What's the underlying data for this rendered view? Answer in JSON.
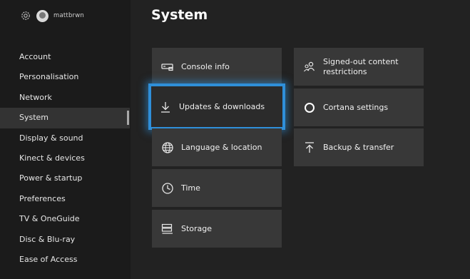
{
  "header": {
    "username": "mattbrwn",
    "page_title": "System"
  },
  "sidebar": {
    "items": [
      {
        "label": "Account",
        "active": false
      },
      {
        "label": "Personalisation",
        "active": false
      },
      {
        "label": "Network",
        "active": false
      },
      {
        "label": "System",
        "active": true
      },
      {
        "label": "Display & sound",
        "active": false
      },
      {
        "label": "Kinect & devices",
        "active": false
      },
      {
        "label": "Power & startup",
        "active": false
      },
      {
        "label": "Preferences",
        "active": false
      },
      {
        "label": "TV & OneGuide",
        "active": false
      },
      {
        "label": "Disc & Blu-ray",
        "active": false
      },
      {
        "label": "Ease of Access",
        "active": false
      }
    ]
  },
  "tiles": {
    "console_info": {
      "label": "Console info",
      "icon": "console-icon"
    },
    "updates": {
      "label": "Updates & downloads",
      "icon": "download-icon",
      "focused": true
    },
    "language": {
      "label": "Language & location",
      "icon": "globe-icon"
    },
    "time": {
      "label": "Time",
      "icon": "clock-icon"
    },
    "storage": {
      "label": "Storage",
      "icon": "storage-icon"
    },
    "signed_out": {
      "label": "Signed-out content restrictions",
      "icon": "users-lock-icon"
    },
    "cortana": {
      "label": "Cortana settings",
      "icon": "cortana-icon"
    },
    "backup": {
      "label": "Backup & transfer",
      "icon": "upload-icon"
    }
  },
  "colors": {
    "focus": "#2f8fd9",
    "tile": "#383838",
    "background": "#222222",
    "sidebar": "#1b1b1b"
  }
}
